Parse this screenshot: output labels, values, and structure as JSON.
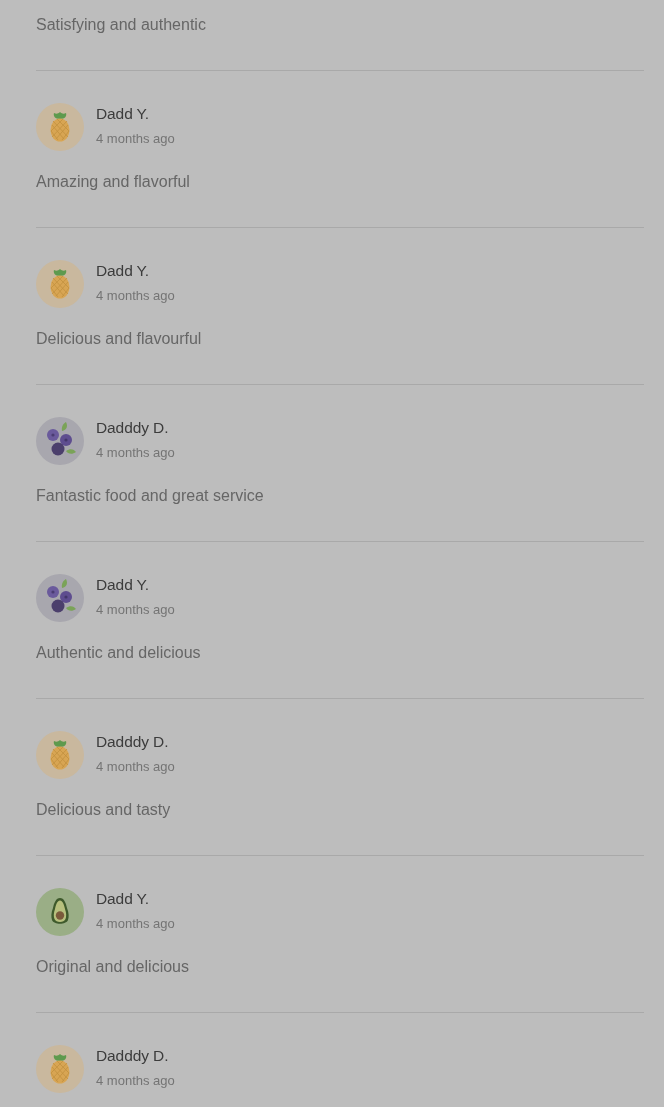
{
  "reviews": [
    {
      "comment": "Satisfying and authentic"
    },
    {
      "avatar": {
        "kind": "pineapple"
      },
      "name": "Dadd Y.",
      "time": "4 months ago",
      "comment": "Amazing and flavorful"
    },
    {
      "avatar": {
        "kind": "pineapple"
      },
      "name": "Dadd Y.",
      "time": "4 months ago",
      "comment": "Delicious and flavourful"
    },
    {
      "avatar": {
        "kind": "blueberries"
      },
      "name": "Dadddy D.",
      "time": "4 months ago",
      "comment": "Fantastic food and great service"
    },
    {
      "avatar": {
        "kind": "blueberries"
      },
      "name": "Dadd Y.",
      "time": "4 months ago",
      "comment": "Authentic and delicious"
    },
    {
      "avatar": {
        "kind": "pineapple"
      },
      "name": "Dadddy D.",
      "time": "4 months ago",
      "comment": "Delicious and tasty"
    },
    {
      "avatar": {
        "kind": "avocado"
      },
      "name": "Dadd Y.",
      "time": "4 months ago",
      "comment": "Original and delicious"
    },
    {
      "avatar": {
        "kind": "pineapple"
      },
      "name": "Dadddy D.",
      "time": "4 months ago"
    }
  ]
}
